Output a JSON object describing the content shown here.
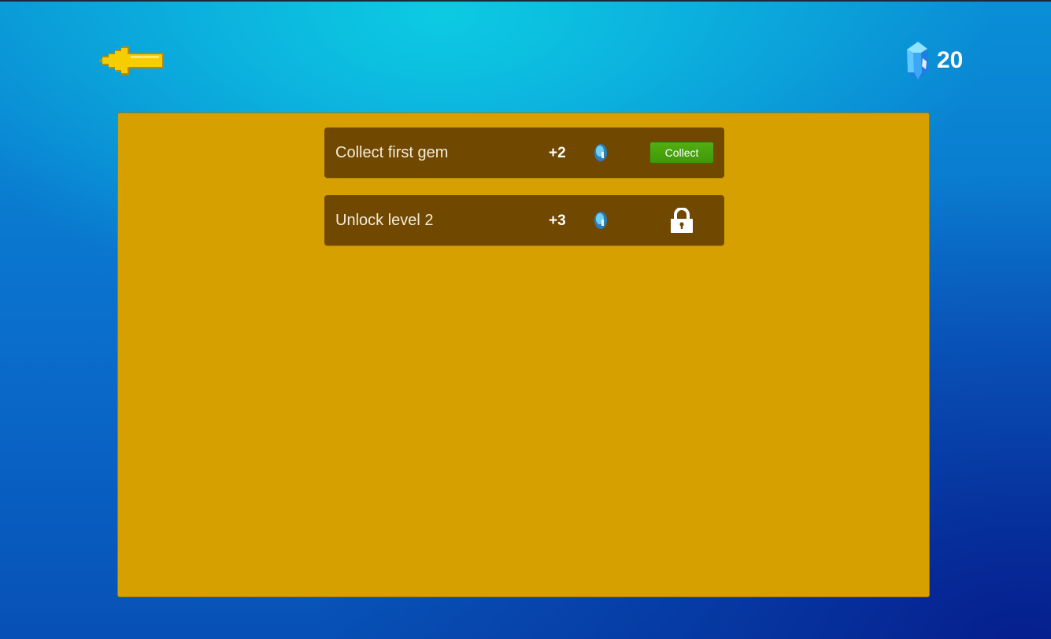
{
  "gem_count": "20",
  "achievements": [
    {
      "title": "Collect first gem",
      "reward": "+2",
      "state": "collectable",
      "button_label": "Collect"
    },
    {
      "title": "Unlock level 2",
      "reward": "+3",
      "state": "locked"
    }
  ],
  "icons": {
    "back": "back-arrow-icon",
    "currency": "gem-icon",
    "locked": "lock-icon"
  },
  "colors": {
    "panel": "#d5a000",
    "row": "#704800",
    "collect_button": "#49a20d",
    "arrow": "#f2c800"
  }
}
